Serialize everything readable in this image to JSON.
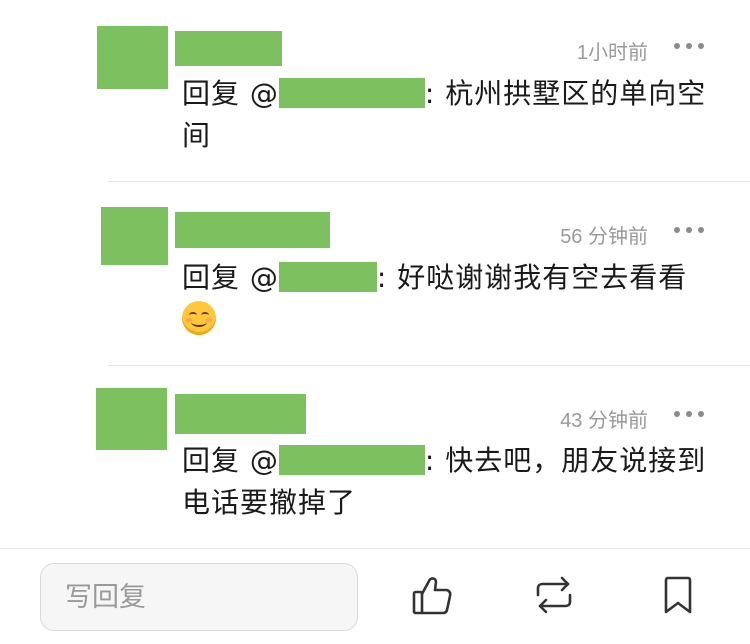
{
  "comments": [
    {
      "time": "1小时前",
      "reply_prefix": "回复 @",
      "text": ": 杭州拱墅区的单向空间",
      "emoji": null
    },
    {
      "time": "56 分钟前",
      "reply_prefix": "回复 @",
      "text": ": 好哒谢谢我有空去看看",
      "emoji": "smiling-face"
    },
    {
      "time": "43 分钟前",
      "reply_prefix": "回复 @",
      "text": ": 快去吧，朋友说接到电话要撤掉了",
      "emoji": null
    }
  ],
  "bottom_bar": {
    "reply_placeholder": "写回复",
    "like_icon": "thumbs-up-icon",
    "repost_icon": "repost-icon",
    "bookmark_icon": "bookmark-icon"
  },
  "colors": {
    "redaction": "#7cc060",
    "meta_text": "#9a9a9a",
    "divider": "#e4e4e4"
  }
}
